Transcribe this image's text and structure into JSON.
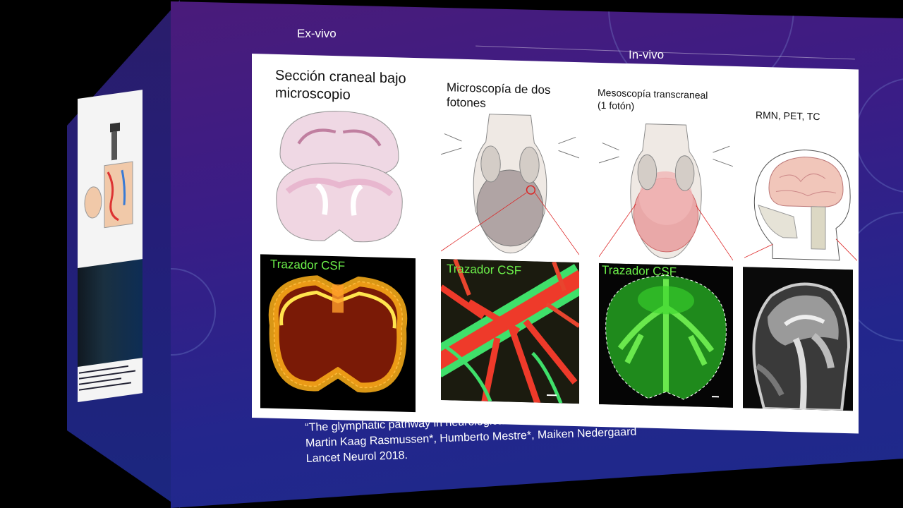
{
  "slide": {
    "label_ex_vivo": "Ex-vivo",
    "label_in_vivo": "In-vivo",
    "columns": [
      {
        "title": "Sección craneal bajo microscopio",
        "tracer": "Trazador CSF"
      },
      {
        "title": "Microscopía de dos fotones",
        "tracer": "Trazador CSF"
      },
      {
        "title": "Mesoscopía transcraneal (1 fotón)",
        "tracer": "Trazador CSF"
      },
      {
        "title": "RMN, PET, TC",
        "tracer": ""
      }
    ],
    "citation": {
      "line1": "“The glymphatic pathway in neurological disorders”",
      "line2": "Martin Kaag Rasmussen*, Humberto Mestre*, Maiken Nedergaard",
      "line3": "Lancet Neurol 2018."
    }
  },
  "colors": {
    "background": "#000000",
    "slide_purple": "#4a1b7a",
    "slide_blue": "#23268c",
    "tracer_green": "#6cf04a",
    "vessel_red": "#e8322a"
  }
}
